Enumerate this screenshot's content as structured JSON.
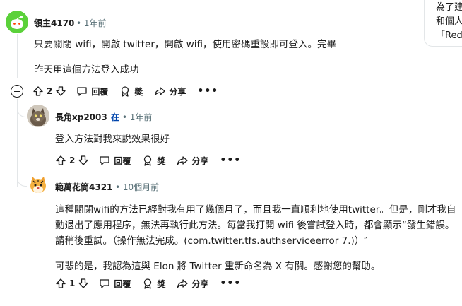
{
  "sidebar": {
    "lines": [
      "為了建",
      "和個人",
      "「Red"
    ]
  },
  "comments": [
    {
      "author": "領主4170",
      "op_badge": "",
      "separator": "•",
      "time": "1年前",
      "paragraphs": [
        "只要關閉 wifi，開啟 twitter，開啟 wifi，使用密碼重設即可登入。完畢",
        "昨天用這個方法登入成功"
      ],
      "votes": "2",
      "reply_label": "回覆",
      "award_label": "獎",
      "share_label": "分享",
      "more_label": "•••"
    },
    {
      "author": "長角xp2003",
      "op_badge": "在",
      "separator": "•",
      "time": "1年前",
      "paragraphs": [
        "登入方法對我來說效果很好"
      ],
      "votes": "2",
      "reply_label": "回覆",
      "award_label": "獎",
      "share_label": "分享",
      "more_label": "•••"
    },
    {
      "author": "範萬花筒4321",
      "op_badge": "",
      "separator": "•",
      "time": "10個月前",
      "paragraphs": [
        "這種關閉wifi的方法已經對我有用了幾個月了，而且我一直順利地使用twitter。但是，剛才我自動退出了應用程序，無法再執行此方法。每當我打開 wifi 後嘗試登入時，都會顯示“發生錯誤。請稍後重試。（操作無法完成。(com.twitter.tfs.authserviceerror 7.)）″",
        "可悲的是，我認為這與 Elon 將 Twitter 重新命名為 X 有關。感謝您的幫助。"
      ],
      "votes": "1",
      "reply_label": "回覆",
      "award_label": "獎",
      "share_label": "分享",
      "more_label": "•••"
    }
  ]
}
